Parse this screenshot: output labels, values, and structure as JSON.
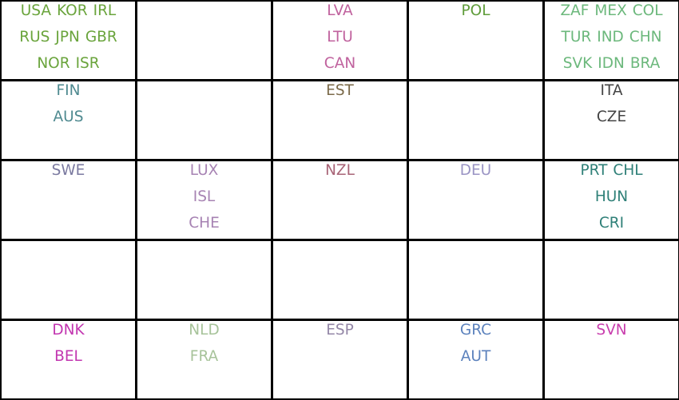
{
  "grid": {
    "rows": 5,
    "columns": 5,
    "cells": [
      {
        "color": "#6aa43c",
        "lines": [
          [
            "USA",
            "KOR",
            "IRL"
          ],
          [
            "RUS",
            "JPN",
            "GBR"
          ],
          [
            "NOR",
            "ISR"
          ]
        ]
      },
      {
        "color": "",
        "lines": []
      },
      {
        "color": "#c0629e",
        "lines": [
          [
            "LVA"
          ],
          [
            "LTU"
          ],
          [
            "CAN"
          ]
        ]
      },
      {
        "color": "#5f9c3a",
        "lines": [
          [
            "POL"
          ]
        ]
      },
      {
        "color": "#6cb87c",
        "lines": [
          [
            "ZAF",
            "MEX",
            "COL"
          ],
          [
            "TUR",
            "IND",
            "CHN"
          ],
          [
            "SVK",
            "IDN",
            "BRA"
          ]
        ]
      },
      {
        "color": "#4f8a90",
        "lines": [
          [
            "FIN"
          ],
          [
            "AUS"
          ]
        ]
      },
      {
        "color": "",
        "lines": []
      },
      {
        "color": "#7b6a4a",
        "lines": [
          [
            "EST"
          ]
        ]
      },
      {
        "color": "",
        "lines": []
      },
      {
        "color": "#444444",
        "lines": [
          [
            "ITA"
          ],
          [
            "CZE"
          ]
        ]
      },
      {
        "color": "#7b7aa0",
        "lines": [
          [
            "SWE"
          ]
        ]
      },
      {
        "color": "#a783b3",
        "lines": [
          [
            "LUX"
          ],
          [
            "ISL"
          ],
          [
            "CHE"
          ]
        ]
      },
      {
        "color": "#a86477",
        "lines": [
          [
            "NZL"
          ]
        ]
      },
      {
        "color": "#9a94c4",
        "lines": [
          [
            "DEU"
          ]
        ]
      },
      {
        "color": "#2f8078",
        "lines": [
          [
            "PRT",
            "CHL"
          ],
          [
            "HUN"
          ],
          [
            "CRI"
          ]
        ]
      },
      {
        "color": "",
        "lines": []
      },
      {
        "color": "",
        "lines": []
      },
      {
        "color": "",
        "lines": []
      },
      {
        "color": "",
        "lines": []
      },
      {
        "color": "",
        "lines": []
      },
      {
        "color": "#c236b0",
        "lines": [
          [
            "DNK"
          ],
          [
            "BEL"
          ]
        ]
      },
      {
        "color": "#a7c39a",
        "lines": [
          [
            "NLD"
          ],
          [
            "FRA"
          ]
        ]
      },
      {
        "color": "#9487a7",
        "lines": [
          [
            "ESP"
          ]
        ]
      },
      {
        "color": "#5c82bd",
        "lines": [
          [
            "GRC"
          ],
          [
            "AUT"
          ]
        ]
      },
      {
        "color": "#c93fae",
        "lines": [
          [
            "SVN"
          ]
        ]
      }
    ]
  }
}
